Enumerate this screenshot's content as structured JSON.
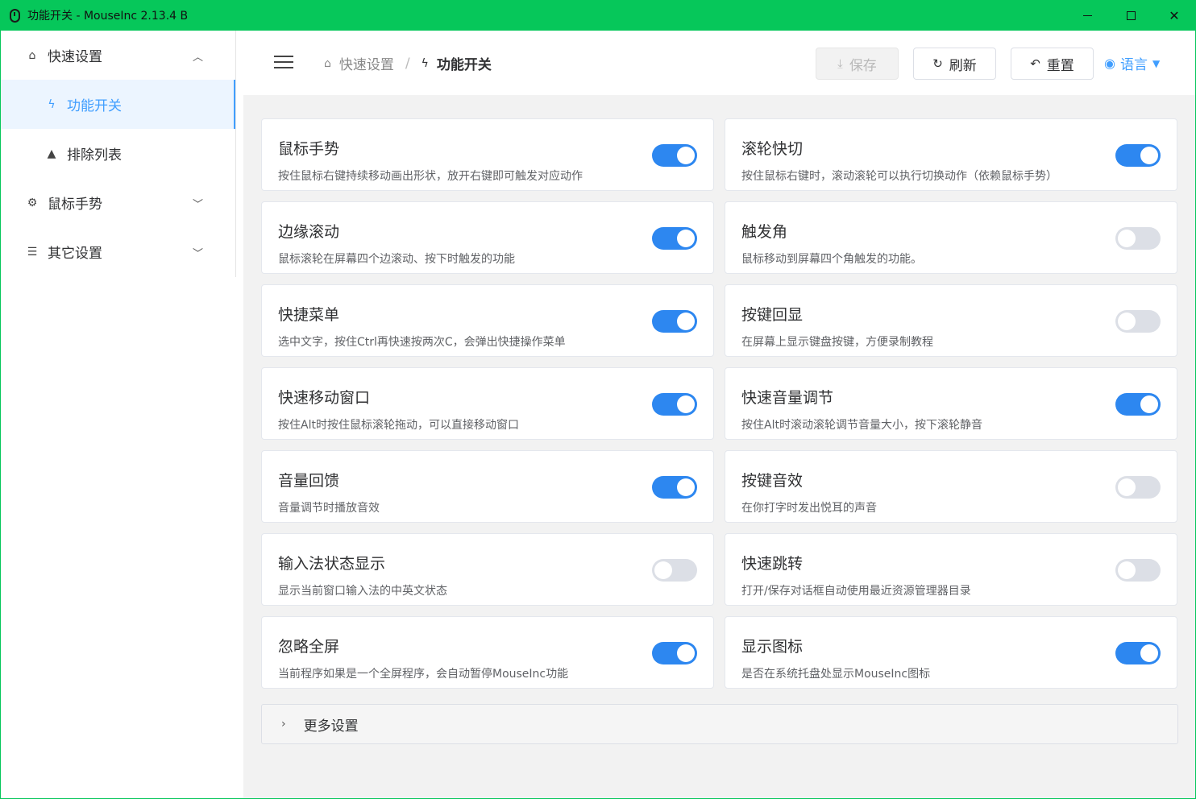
{
  "window": {
    "title": "功能开关 - MouseInc 2.13.4 B",
    "minimize_icon": "minimize-icon",
    "maximize_icon": "maximize-icon",
    "close_label": "✕"
  },
  "sidebar": {
    "items": [
      {
        "label": "快速设置",
        "icon": "home-icon",
        "glyph": "⌂",
        "chevron": "︿"
      },
      {
        "label": "功能开关",
        "icon": "lightning-icon",
        "glyph": "ϟ"
      },
      {
        "label": "排除列表",
        "icon": "warning-icon",
        "glyph": "▲"
      },
      {
        "label": "鼠标手势",
        "icon": "gear-icon",
        "glyph": "⚙",
        "chevron": "﹀"
      },
      {
        "label": "其它设置",
        "icon": "sliders-icon",
        "glyph": "☰",
        "chevron": "﹀"
      }
    ]
  },
  "header": {
    "breadcrumb": {
      "home_glyph": "⌂",
      "home_label": "快速设置",
      "separator": "/",
      "current_glyph": "ϟ",
      "current_label": "功能开关"
    },
    "save_label": "保存",
    "save_glyph": "⤓",
    "refresh_label": "刷新",
    "refresh_glyph": "↻",
    "reset_label": "重置",
    "reset_glyph": "↶",
    "language_label": "语言",
    "language_glyph": "◉",
    "language_caret": "▼"
  },
  "features": [
    {
      "title": "鼠标手势",
      "desc": "按住鼠标右键持续移动画出形状，放开右键即可触发对应动作",
      "enabled": true
    },
    {
      "title": "滚轮快切",
      "desc": "按住鼠标右键时，滚动滚轮可以执行切换动作（依赖鼠标手势）",
      "enabled": true
    },
    {
      "title": "边缘滚动",
      "desc": "鼠标滚轮在屏幕四个边滚动、按下时触发的功能",
      "enabled": true
    },
    {
      "title": "触发角",
      "desc": "鼠标移动到屏幕四个角触发的功能。",
      "enabled": false
    },
    {
      "title": "快捷菜单",
      "desc": "选中文字，按住Ctrl再快速按两次C，会弹出快捷操作菜单",
      "enabled": true
    },
    {
      "title": "按键回显",
      "desc": "在屏幕上显示键盘按键，方便录制教程",
      "enabled": false
    },
    {
      "title": "快速移动窗口",
      "desc": "按住Alt时按住鼠标滚轮拖动，可以直接移动窗口",
      "enabled": true
    },
    {
      "title": "快速音量调节",
      "desc": "按住Alt时滚动滚轮调节音量大小，按下滚轮静音",
      "enabled": true
    },
    {
      "title": "音量回馈",
      "desc": "音量调节时播放音效",
      "enabled": true
    },
    {
      "title": "按键音效",
      "desc": "在你打字时发出悦耳的声音",
      "enabled": false
    },
    {
      "title": "输入法状态显示",
      "desc": "显示当前窗口输入法的中英文状态",
      "enabled": false
    },
    {
      "title": "快速跳转",
      "desc": "打开/保存对话框自动使用最近资源管理器目录",
      "enabled": false
    },
    {
      "title": "忽略全屏",
      "desc": "当前程序如果是一个全屏程序，会自动暂停MouseInc功能",
      "enabled": true
    },
    {
      "title": "显示图标",
      "desc": "是否在系统托盘处显示MouseInc图标",
      "enabled": true
    }
  ],
  "more_settings": {
    "label": "更多设置",
    "chevron": "›"
  },
  "colors": {
    "titlebar": "#06c75a",
    "accent": "#409eff",
    "toggle_on": "#2d87f0",
    "toggle_off": "#dcdfe6"
  }
}
